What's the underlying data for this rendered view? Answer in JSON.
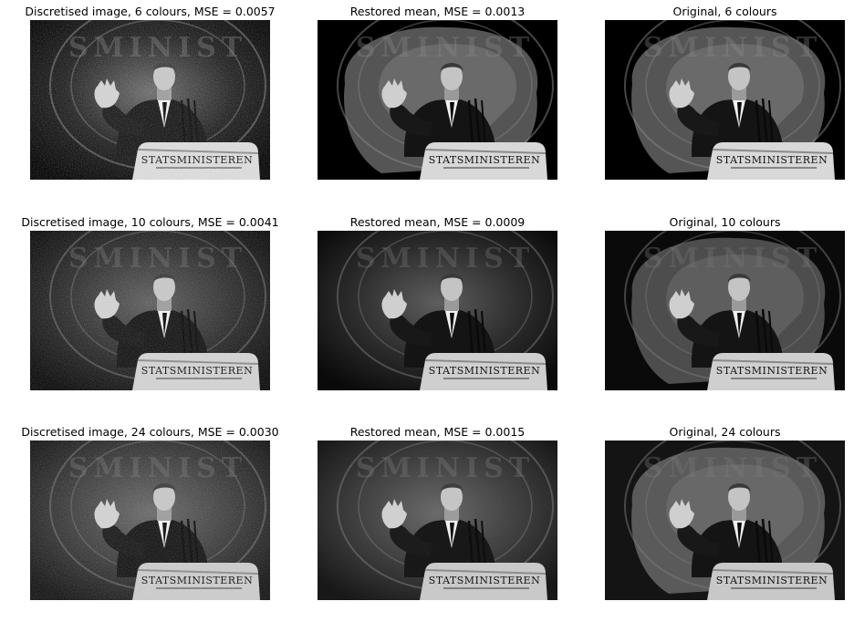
{
  "figure": {
    "rows": [
      {
        "colours": 6,
        "panels": [
          {
            "title": "Discretised image, 6 colours, MSE = 0.0057",
            "kind": "discretised"
          },
          {
            "title": "Restored mean, MSE = 0.0013",
            "kind": "restored"
          },
          {
            "title": "Original, 6 colours",
            "kind": "original"
          }
        ]
      },
      {
        "colours": 10,
        "panels": [
          {
            "title": "Discretised image, 10 colours, MSE = 0.0041",
            "kind": "discretised"
          },
          {
            "title": "Restored mean, MSE = 0.0009",
            "kind": "restored"
          },
          {
            "title": "Original, 10 colours",
            "kind": "original"
          }
        ]
      },
      {
        "colours": 24,
        "panels": [
          {
            "title": "Discretised image, 24 colours, MSE = 0.0030",
            "kind": "discretised"
          },
          {
            "title": "Restored mean, MSE = 0.0015",
            "kind": "restored"
          },
          {
            "title": "Original, 24 colours",
            "kind": "original"
          }
        ]
      }
    ],
    "podium_text": "STATSMINISTEREN",
    "seal_text": "STATSMINISTEREN"
  }
}
